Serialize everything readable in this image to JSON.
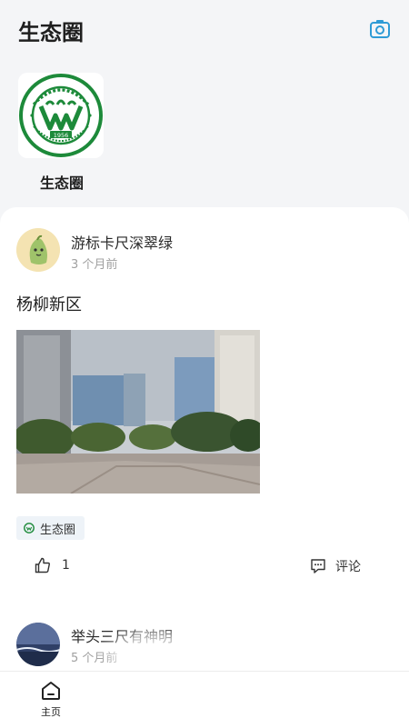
{
  "header": {
    "title": "生态圈",
    "camera_icon": "camera-icon"
  },
  "circle": {
    "label": "生态圈",
    "logo": {
      "year": "1956",
      "brand_color": "#1d8a3a"
    }
  },
  "posts": [
    {
      "user": "游标卡尺深翠绿",
      "time": "3 个月前",
      "content": "杨柳新区",
      "tag": "生态圈",
      "likes": "1",
      "comment_label": "评论"
    },
    {
      "user": "举头三尺有神明",
      "time": "5 个月前"
    }
  ],
  "tabbar": {
    "home_label": "主页"
  },
  "colors": {
    "accent": "#2e9bd6",
    "background": "#f4f5f7",
    "card": "#ffffff"
  }
}
